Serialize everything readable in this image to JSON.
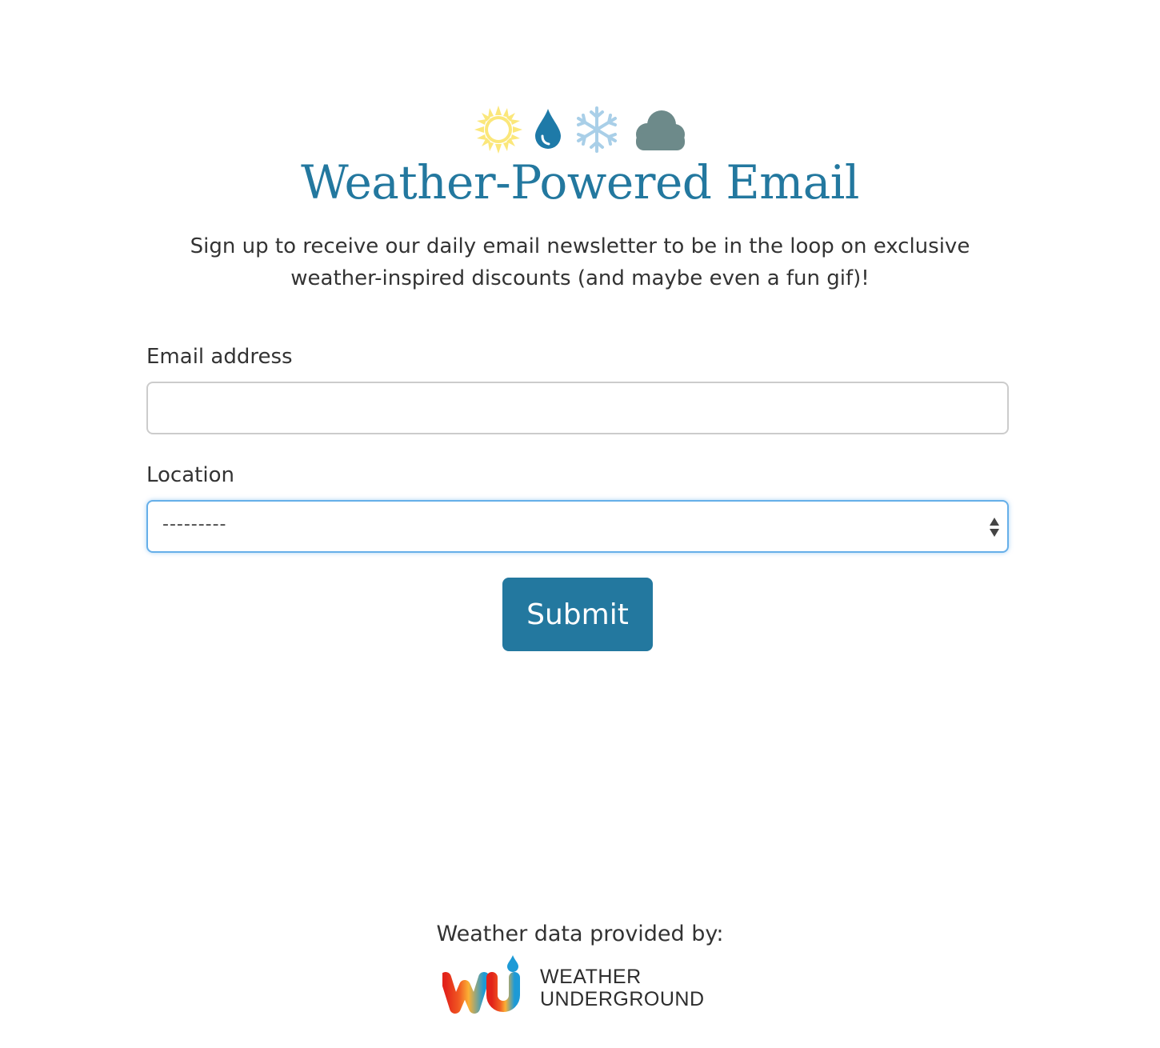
{
  "header": {
    "icons": [
      "sun-icon",
      "raindrop-icon",
      "snowflake-icon",
      "cloud-icon"
    ],
    "title": "Weather-Powered Email",
    "intro": "Sign up to receive our daily email newsletter to be in the loop on exclusive weather-inspired discounts (and maybe even a fun gif)!"
  },
  "form": {
    "email_label": "Email address",
    "email_value": "",
    "location_label": "Location",
    "location_selected": "---------",
    "submit_label": "Submit"
  },
  "footer": {
    "provided_by": "Weather data provided by:",
    "logo_line1": "WEATHER",
    "logo_line2": "UNDERGROUND"
  },
  "colors": {
    "brand_blue": "#23789f",
    "sun_yellow": "#fbe77a",
    "drop_blue": "#1e7aa8",
    "snow_blue": "#a9cfe8",
    "cloud_gray": "#6d8a8a",
    "focus_blue": "#66afe9"
  }
}
